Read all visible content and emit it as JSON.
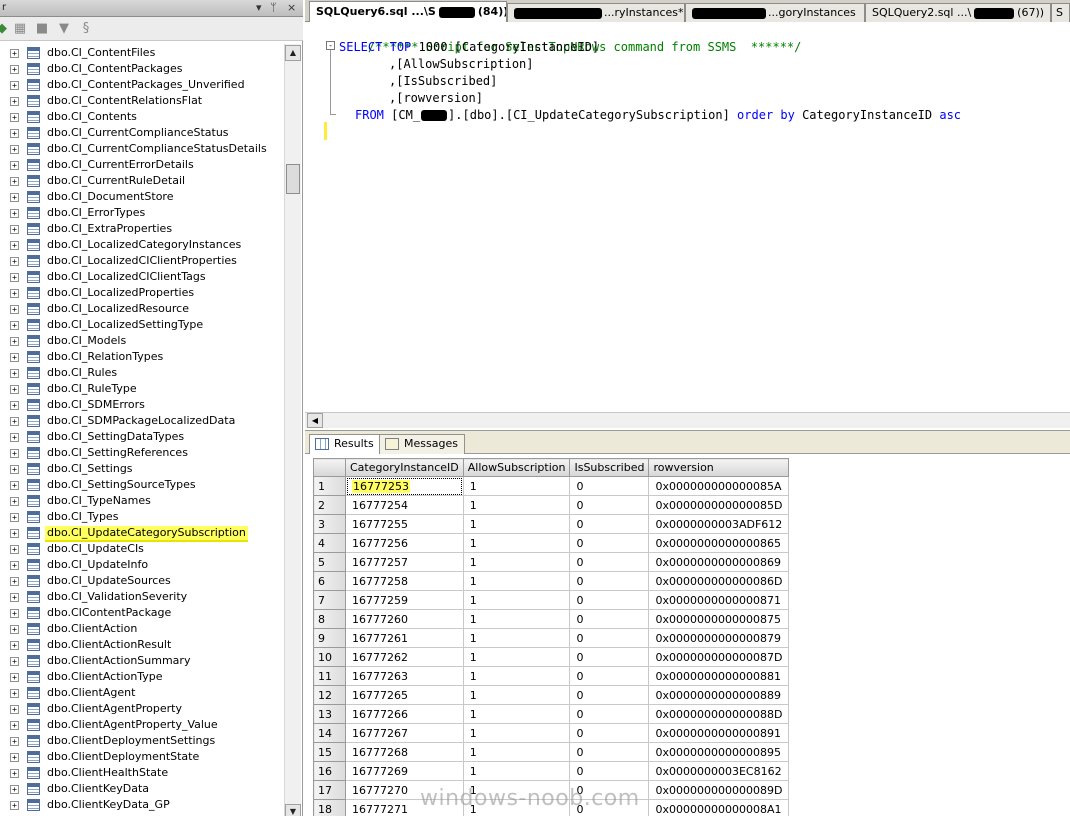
{
  "object_explorer": {
    "title": "r",
    "title_buttons": [
      "▾",
      "ᛘ",
      "×"
    ],
    "tree_items": [
      {
        "label": "dbo.CI_ContentFiles"
      },
      {
        "label": "dbo.CI_ContentPackages"
      },
      {
        "label": "dbo.CI_ContentPackages_Unverified"
      },
      {
        "label": "dbo.CI_ContentRelationsFlat"
      },
      {
        "label": "dbo.CI_Contents"
      },
      {
        "label": "dbo.CI_CurrentComplianceStatus"
      },
      {
        "label": "dbo.CI_CurrentComplianceStatusDetails"
      },
      {
        "label": "dbo.CI_CurrentErrorDetails"
      },
      {
        "label": "dbo.CI_CurrentRuleDetail"
      },
      {
        "label": "dbo.CI_DocumentStore"
      },
      {
        "label": "dbo.CI_ErrorTypes"
      },
      {
        "label": "dbo.CI_ExtraProperties"
      },
      {
        "label": "dbo.CI_LocalizedCategoryInstances"
      },
      {
        "label": "dbo.CI_LocalizedCIClientProperties"
      },
      {
        "label": "dbo.CI_LocalizedCIClientTags"
      },
      {
        "label": "dbo.CI_LocalizedProperties"
      },
      {
        "label": "dbo.CI_LocalizedResource"
      },
      {
        "label": "dbo.CI_LocalizedSettingType"
      },
      {
        "label": "dbo.CI_Models"
      },
      {
        "label": "dbo.CI_RelationTypes"
      },
      {
        "label": "dbo.CI_Rules"
      },
      {
        "label": "dbo.CI_RuleType"
      },
      {
        "label": "dbo.CI_SDMErrors"
      },
      {
        "label": "dbo.CI_SDMPackageLocalizedData"
      },
      {
        "label": "dbo.CI_SettingDataTypes"
      },
      {
        "label": "dbo.CI_SettingReferences"
      },
      {
        "label": "dbo.CI_Settings"
      },
      {
        "label": "dbo.CI_SettingSourceTypes"
      },
      {
        "label": "dbo.CI_TypeNames"
      },
      {
        "label": "dbo.CI_Types"
      },
      {
        "label": "dbo.CI_UpdateCategorySubscription",
        "highlighted": true
      },
      {
        "label": "dbo.CI_UpdateCIs"
      },
      {
        "label": "dbo.CI_UpdateInfo"
      },
      {
        "label": "dbo.CI_UpdateSources"
      },
      {
        "label": "dbo.CI_ValidationSeverity"
      },
      {
        "label": "dbo.CIContentPackage"
      },
      {
        "label": "dbo.ClientAction"
      },
      {
        "label": "dbo.ClientActionResult"
      },
      {
        "label": "dbo.ClientActionSummary"
      },
      {
        "label": "dbo.ClientActionType"
      },
      {
        "label": "dbo.ClientAgent"
      },
      {
        "label": "dbo.ClientAgentProperty"
      },
      {
        "label": "dbo.ClientAgentProperty_Value"
      },
      {
        "label": "dbo.ClientDeploymentSettings"
      },
      {
        "label": "dbo.ClientDeploymentState"
      },
      {
        "label": "dbo.ClientHealthState"
      },
      {
        "label": "dbo.ClientKeyData"
      },
      {
        "label": "dbo.ClientKeyData_GP"
      }
    ],
    "expander_glyph": "+"
  },
  "editor_tabs": [
    {
      "label": "SQLQuery6.sql ...\\S",
      "suffix": "(84))*",
      "active": true
    },
    {
      "label": "...ryInstances*",
      "active": false
    },
    {
      "label": "...goryInstances",
      "active": false
    },
    {
      "label": "SQLQuery2.sql ...\\",
      "suffix": "(67))",
      "active": false
    },
    {
      "label": "S",
      "active": false
    }
  ],
  "editor": {
    "comment_line": "/****** Script for SelectTopNRows command from SSMS  ******/",
    "select_kw": "SELECT",
    "top_kw": "TOP",
    "top_value": "1000",
    "col1": "[CategoryInstanceID]",
    "col2": ",[AllowSubscription]",
    "col3": ",[IsSubscribed]",
    "col4": ",[rowversion]",
    "from_kw": "FROM",
    "from_db_prefix": "[CM_",
    "from_rest": "].[dbo].[CI_UpdateCategorySubscription]",
    "order_kw": "order by",
    "order_col": "CategoryInstanceID",
    "asc_kw": "asc",
    "collapse_glyph": "-"
  },
  "results": {
    "tab_results": "Results",
    "tab_messages": "Messages",
    "columns": [
      "CategoryInstanceID",
      "AllowSubscription",
      "IsSubscribed",
      "rowversion"
    ],
    "rows": [
      [
        "1",
        "16777253",
        "1",
        "0",
        "0x000000000000085A"
      ],
      [
        "2",
        "16777254",
        "1",
        "0",
        "0x000000000000085D"
      ],
      [
        "3",
        "16777255",
        "1",
        "0",
        "0x0000000003ADF612"
      ],
      [
        "4",
        "16777256",
        "1",
        "0",
        "0x0000000000000865"
      ],
      [
        "5",
        "16777257",
        "1",
        "0",
        "0x0000000000000869"
      ],
      [
        "6",
        "16777258",
        "1",
        "0",
        "0x000000000000086D"
      ],
      [
        "7",
        "16777259",
        "1",
        "0",
        "0x0000000000000871"
      ],
      [
        "8",
        "16777260",
        "1",
        "0",
        "0x0000000000000875"
      ],
      [
        "9",
        "16777261",
        "1",
        "0",
        "0x0000000000000879"
      ],
      [
        "10",
        "16777262",
        "1",
        "0",
        "0x000000000000087D"
      ],
      [
        "11",
        "16777263",
        "1",
        "0",
        "0x0000000000000881"
      ],
      [
        "12",
        "16777265",
        "1",
        "0",
        "0x0000000000000889"
      ],
      [
        "13",
        "16777266",
        "1",
        "0",
        "0x000000000000088D"
      ],
      [
        "14",
        "16777267",
        "1",
        "0",
        "0x0000000000000891"
      ],
      [
        "15",
        "16777268",
        "1",
        "0",
        "0x0000000000000895"
      ],
      [
        "16",
        "16777269",
        "1",
        "0",
        "0x0000000003EC8162"
      ],
      [
        "17",
        "16777270",
        "1",
        "0",
        "0x000000000000089D"
      ],
      [
        "18",
        "16777271",
        "1",
        "0",
        "0x00000000000008A1"
      ]
    ]
  },
  "watermark": "windows-noob.com"
}
